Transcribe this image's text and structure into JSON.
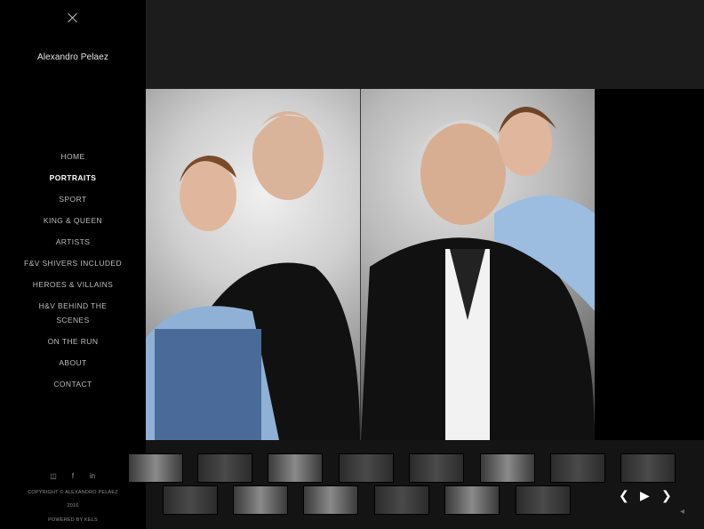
{
  "sidebar": {
    "title": "Alexandro Pelaez",
    "nav": [
      "HOME",
      "PORTRAITS",
      "SPORT",
      "KING & QUEEN",
      "ARTISTS",
      "F&V SHIVERS INCLUDED",
      "HEROES & VILLAINS",
      "H&V BEHIND THE SCENES",
      "ON THE RUN",
      "ABOUT",
      "CONTACT"
    ],
    "active_index": 1,
    "social": [
      "instagram-icon",
      "facebook-icon",
      "linkedin-icon"
    ],
    "copyright": "COPYRIGHT © ALEXANDRO PELAEZ",
    "year": "2016",
    "powered": "POWERED BY KELS"
  },
  "gallery": {
    "icons": {
      "prev": "chevron-left-icon",
      "play": "play-icon",
      "next": "chevron-right-icon",
      "collapse": "collapse-icon"
    }
  }
}
